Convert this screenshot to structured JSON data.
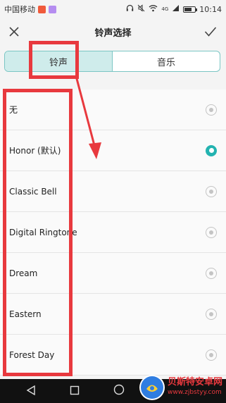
{
  "status_bar": {
    "carrier": "中国移动",
    "network": "4G",
    "time": "10:14",
    "battery_level": 0.7
  },
  "title_bar": {
    "title": "铃声选择",
    "close_icon": "close-icon",
    "confirm_icon": "check-icon"
  },
  "tabs": [
    {
      "label": "铃声",
      "active": true
    },
    {
      "label": "音乐",
      "active": false
    }
  ],
  "ringtones": [
    {
      "label": "无",
      "selected": false
    },
    {
      "label": "Honor (默认)",
      "selected": true
    },
    {
      "label": "Classic Bell",
      "selected": false
    },
    {
      "label": "Digital Ringtone",
      "selected": false
    },
    {
      "label": "Dream",
      "selected": false
    },
    {
      "label": "Eastern",
      "selected": false
    },
    {
      "label": "Forest Day",
      "selected": false
    }
  ],
  "nav_bar": {
    "icons": [
      "back-icon",
      "home-icon",
      "recents-icon"
    ]
  },
  "watermark": {
    "name": "贝斯特安卓网",
    "url": "www.zjbstyy.com"
  },
  "colors": {
    "accent": "#23b3b0",
    "tab_active_bg": "#cfeceb",
    "annotation": "#e8393e"
  }
}
